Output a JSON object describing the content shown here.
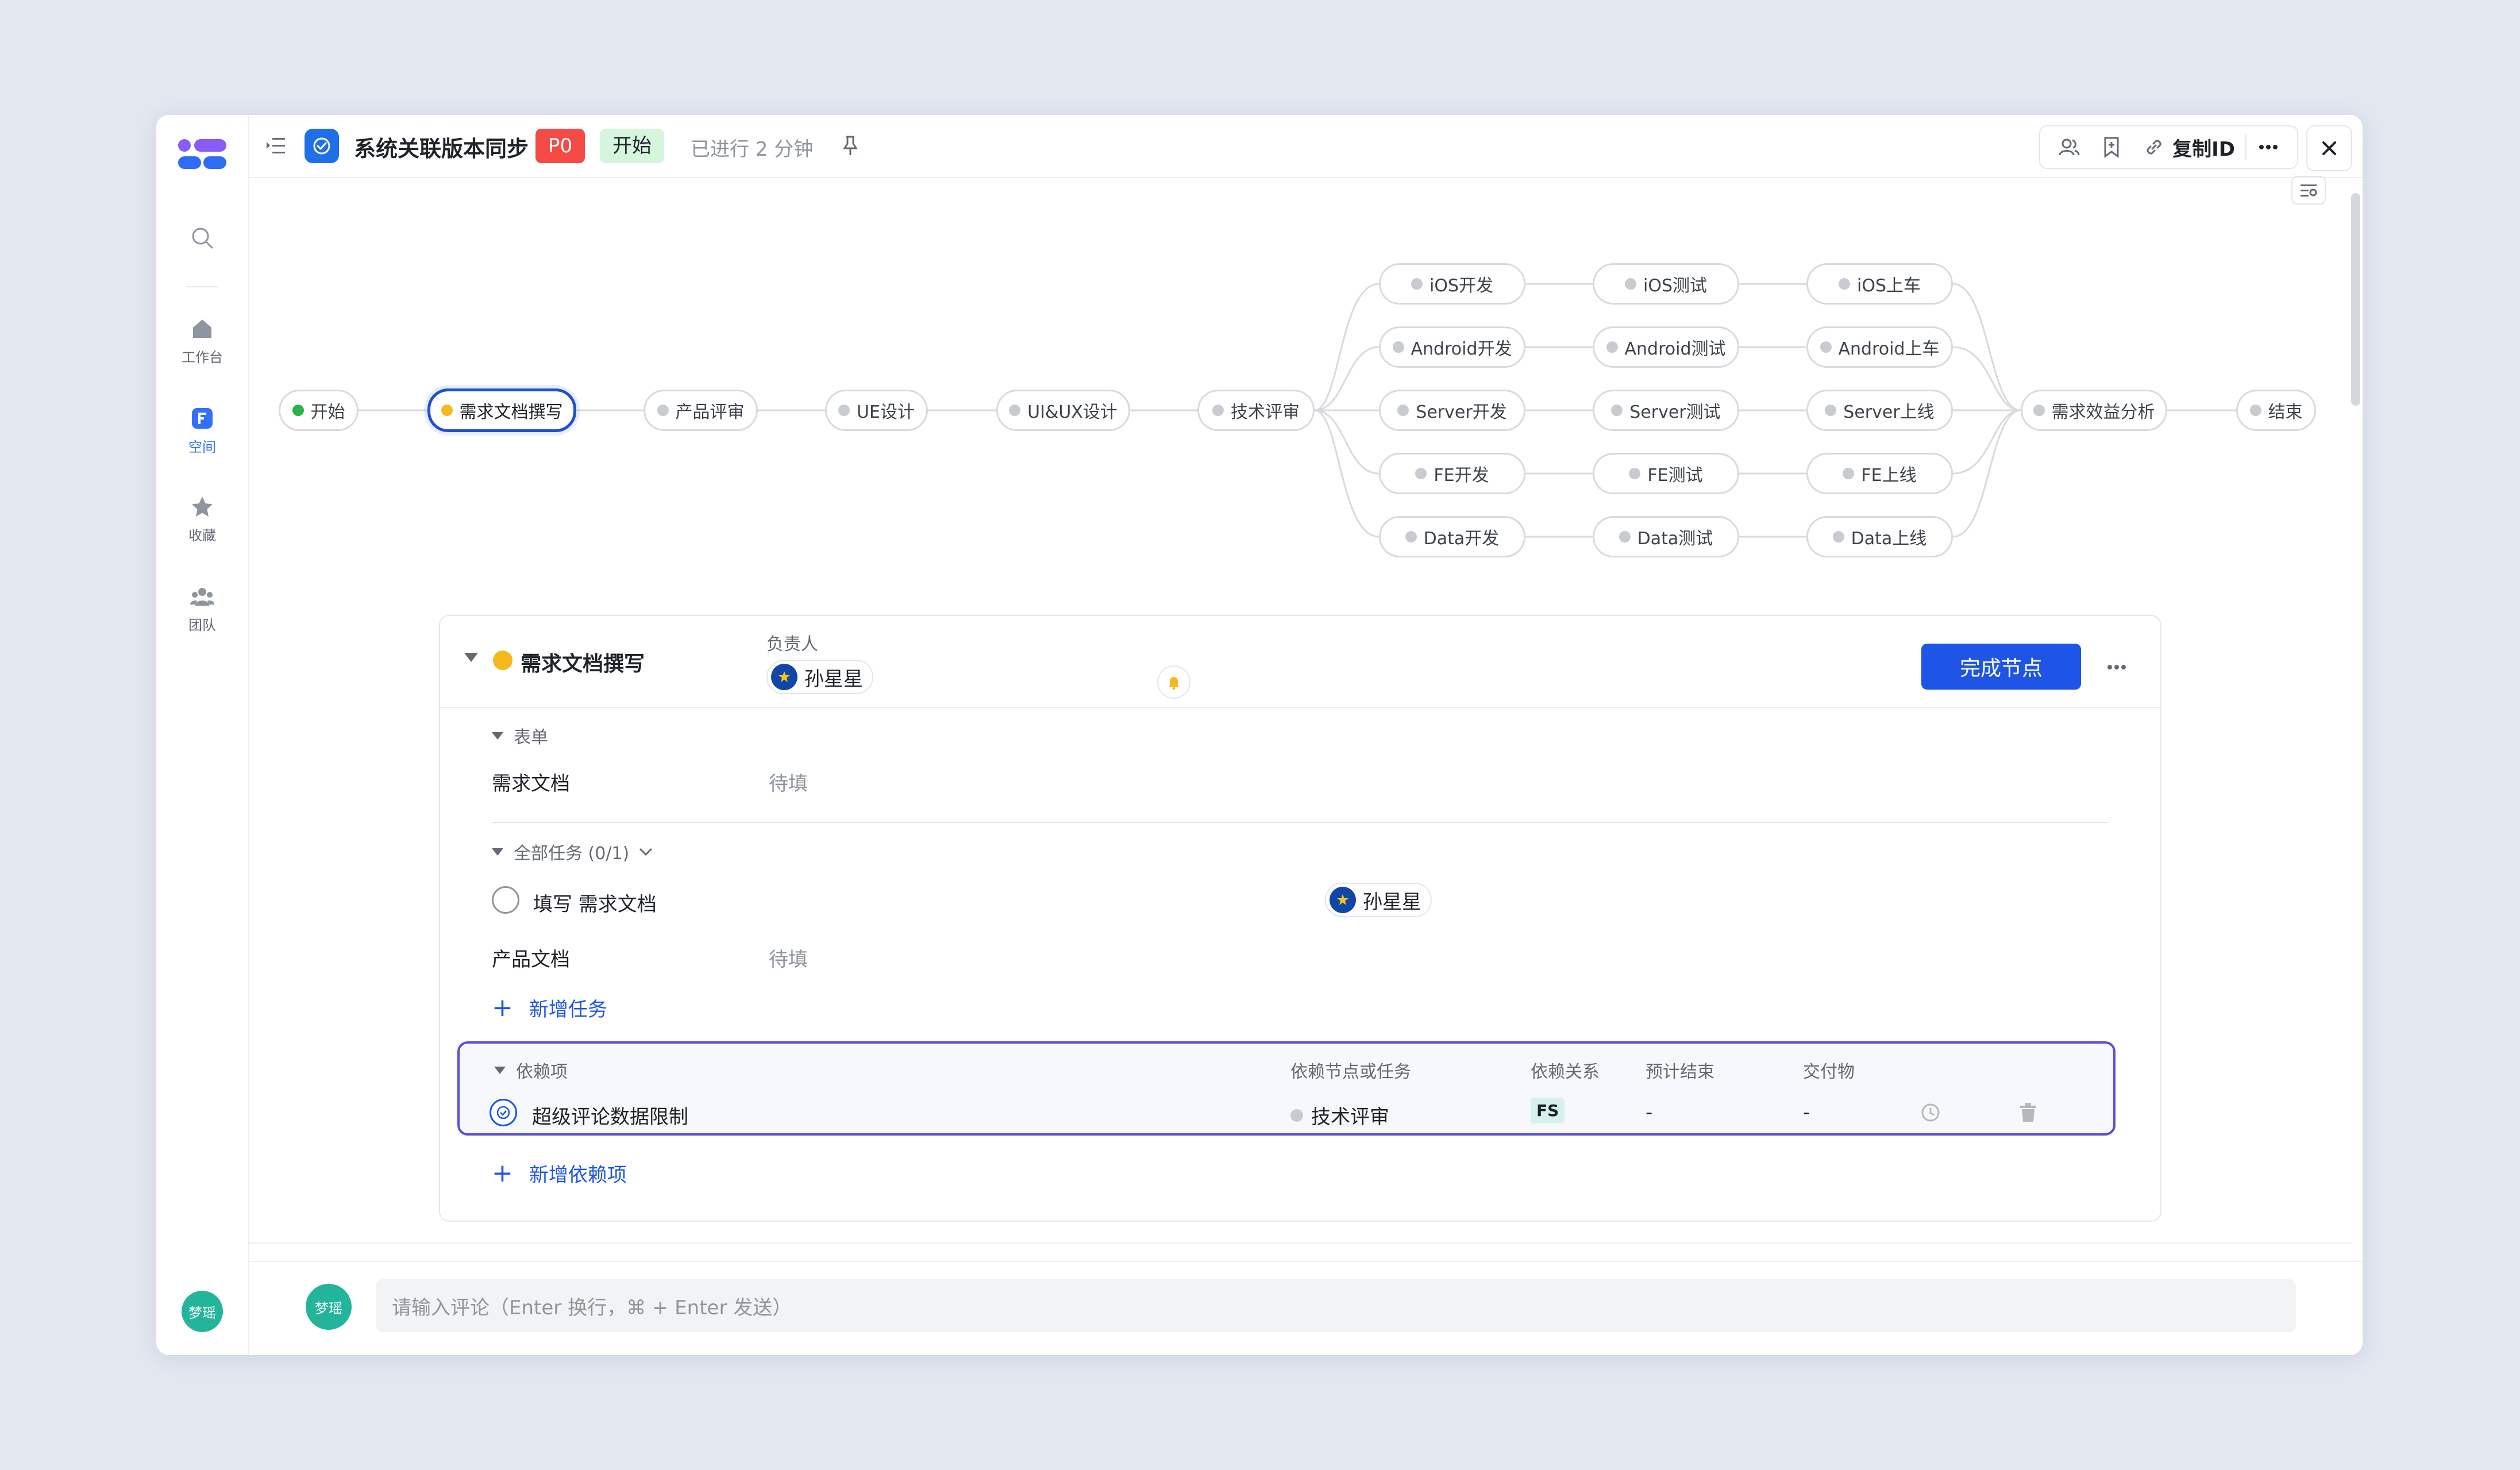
{
  "sidebar": {
    "items": [
      {
        "label": "工作台",
        "icon": "home-icon"
      },
      {
        "label": "空间",
        "icon": "space-icon"
      },
      {
        "label": "收藏",
        "icon": "star-icon"
      },
      {
        "label": "团队",
        "icon": "team-icon"
      }
    ],
    "user_avatar": "梦瑶"
  },
  "header": {
    "title": "系统关联版本同步",
    "priority": "P0",
    "status": "开始",
    "elapsed": "已进行 2 分钟",
    "copy_id_label": "复制ID"
  },
  "flow": {
    "nodes": {
      "start": "开始",
      "req_doc": "需求文档撰写",
      "prod_review": "产品评审",
      "ue": "UE设计",
      "uiux": "UI&UX设计",
      "tech_review": "技术评审",
      "ios_dev": "iOS开发",
      "android_dev": "Android开发",
      "server_dev": "Server开发",
      "fe_dev": "FE开发",
      "data_dev": "Data开发",
      "ios_test": "iOS测试",
      "android_test": "Android测试",
      "server_test": "Server测试",
      "fe_test": "FE测试",
      "data_test": "Data测试",
      "ios_release": "iOS上车",
      "android_release": "Android上车",
      "server_release": "Server上线",
      "fe_release": "FE上线",
      "data_release": "Data上线",
      "benefit": "需求效益分析",
      "end": "结束"
    }
  },
  "detail": {
    "node_title": "需求文档撰写",
    "owner_label": "负责人",
    "owner_name": "孙星星",
    "complete_button": "完成节点",
    "form_section": "表单",
    "form_field_label": "需求文档",
    "form_field_value": "待填",
    "tasks_section": "全部任务 (0/1)",
    "task_name": "填写 需求文档",
    "task_owner": "孙星星",
    "product_doc_label": "产品文档",
    "product_doc_value": "待填",
    "add_task": "新增任务",
    "deps_section": "依赖项",
    "deps_columns": [
      "依赖节点或任务",
      "依赖关系",
      "预计结束",
      "交付物"
    ],
    "dep_row": {
      "name": "超级评论数据限制",
      "node": "技术评审",
      "relation": "FS",
      "end": "-",
      "deliverable": "-"
    },
    "add_dependency": "新增依赖项"
  },
  "comment": {
    "avatar": "梦瑶",
    "placeholder": "请输入评论（Enter 换行，⌘ + Enter 发送）"
  },
  "colors": {
    "accent": "#1f55e6",
    "priority": "#f54a45",
    "status_bg": "#d5f5dc",
    "current_dot": "#f5b81f",
    "start_dot": "#2bb24c",
    "avatar_green": "#23b59c"
  }
}
